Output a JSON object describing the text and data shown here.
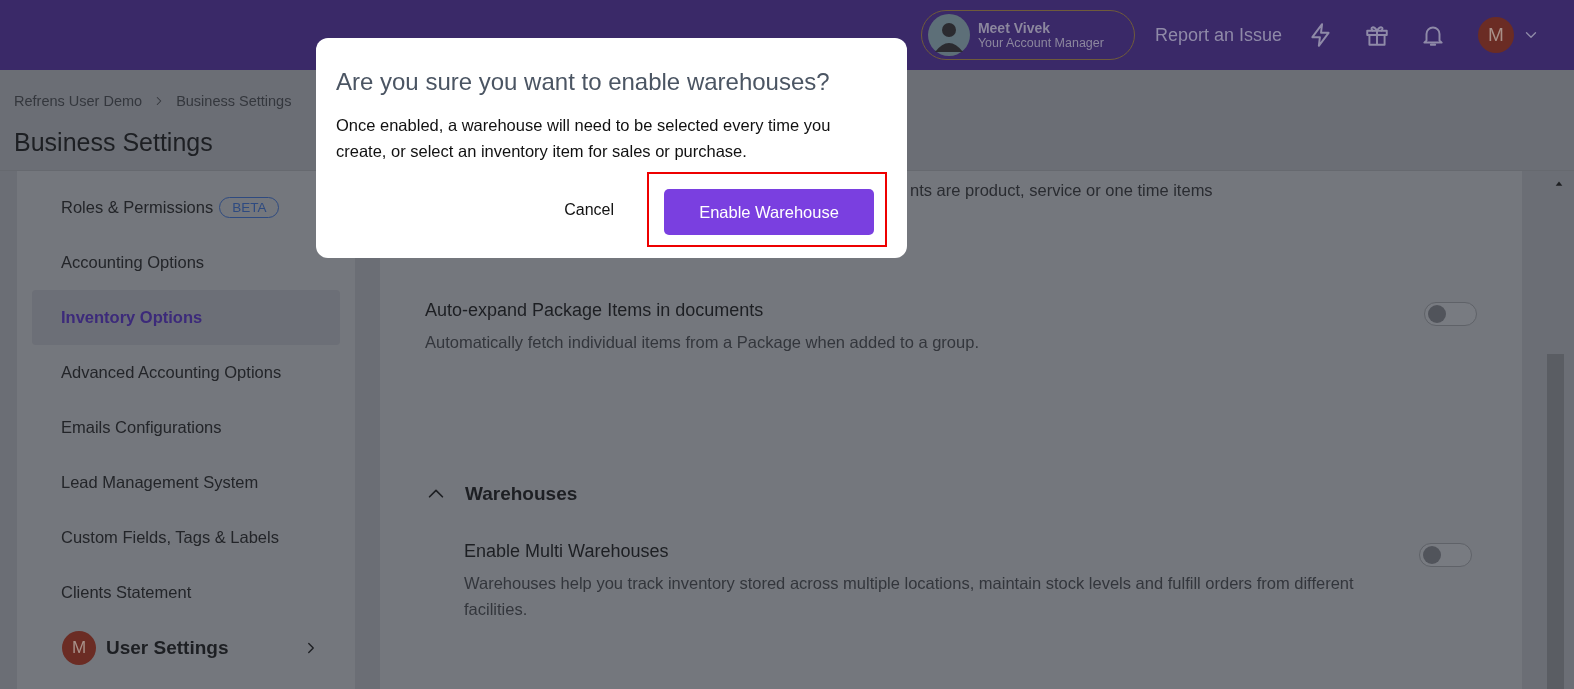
{
  "header": {
    "account_manager": {
      "name": "Meet Vivek",
      "role": "Your Account Manager"
    },
    "report_link": "Report an Issue",
    "avatar_letter": "M"
  },
  "breadcrumb": [
    "Refrens User Demo",
    "Business Settings"
  ],
  "page_title": "Business Settings",
  "sidebar": {
    "items": [
      {
        "label": "Roles & Permissions",
        "badge": "BETA",
        "selected": false
      },
      {
        "label": "Accounting Options",
        "selected": false
      },
      {
        "label": "Inventory Options",
        "selected": true
      },
      {
        "label": "Advanced Accounting Options",
        "selected": false
      },
      {
        "label": "Emails Configurations",
        "selected": false
      },
      {
        "label": "Lead Management System",
        "selected": false
      },
      {
        "label": "Custom Fields, Tags & Labels",
        "selected": false
      },
      {
        "label": "Clients Statement",
        "selected": false
      }
    ],
    "user_settings": {
      "avatar_letter": "M",
      "label": "User Settings"
    }
  },
  "content": {
    "partial_text": "nts are product, service or one time items",
    "settings": [
      {
        "title": "Auto-expand Package Items in documents",
        "description": "Automatically fetch individual items from a Package when added to a group.",
        "on": false
      }
    ],
    "sections": [
      {
        "title": "Warehouses",
        "expanded": true,
        "settings": [
          {
            "title": "Enable Multi Warehouses",
            "description": "Warehouses help you track inventory stored across multiple locations, maintain stock levels and fulfill orders from different facilities.",
            "on": false
          }
        ]
      }
    ]
  },
  "dialog": {
    "title": "Are you sure you want to enable warehouses?",
    "message": "Once enabled, a warehouse will need to be selected every time you create, or select an inventory item for sales or purchase.",
    "buttons": [
      {
        "label": "Cancel",
        "kind": "text",
        "highlighted": false
      },
      {
        "label": "Enable Warehouse",
        "kind": "primary",
        "highlighted": true
      }
    ]
  }
}
